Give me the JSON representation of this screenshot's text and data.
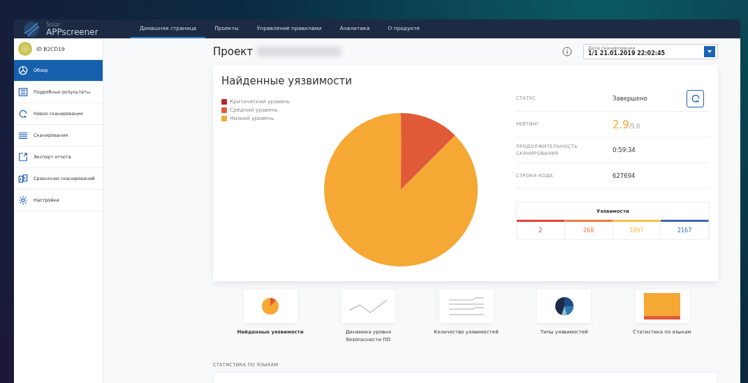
{
  "app": {
    "logo_small": "Solar",
    "logo_main": "APPscreener"
  },
  "nav": [
    {
      "label": "Домашняя страница",
      "selected": true
    },
    {
      "label": "Проекты",
      "selected": false
    },
    {
      "label": "Управление правилами",
      "selected": false
    },
    {
      "label": "Аналитика",
      "selected": false
    },
    {
      "label": "О продукте",
      "selected": false
    }
  ],
  "user": {
    "id": "ID B2CD19"
  },
  "sidebar": {
    "items": [
      {
        "label": "Обзор",
        "selected": true
      },
      {
        "label": "Подробные результаты",
        "selected": false
      },
      {
        "label": "Новое сканирование",
        "selected": false
      },
      {
        "label": "Сканирования",
        "selected": false
      },
      {
        "label": "Экспорт отчета",
        "selected": false
      },
      {
        "label": "Сравнение сканирований",
        "selected": false
      },
      {
        "label": "Настройки",
        "selected": false
      }
    ]
  },
  "project": {
    "title": "Проект"
  },
  "scan_date": {
    "label": "Дата сканирования",
    "value": "1/1 21.01.2019 22:02:45"
  },
  "findings": {
    "title": "Найденные уязвимости",
    "chart_data": {
      "type": "pie",
      "categories": [
        "Критический уровень",
        "Средний уровень",
        "Низкий уровень"
      ],
      "values": [
        0.1,
        12.4,
        87.5
      ],
      "legend": "top-left",
      "colors": [
        "#b8272f",
        "#e05a38",
        "#f5a833"
      ]
    }
  },
  "stats": [
    {
      "label": "СТАТУС",
      "value": "Завершено"
    },
    {
      "label": "РЕЙТИНГ",
      "value": "2.9",
      "suffix": "/5.0"
    },
    {
      "label": "ПРОДОЛЖИТЕЛЬНОСТЬ СКАНИРОВАНИЯ",
      "value": "0:59:34"
    },
    {
      "label": "СТРОКИ КОДА",
      "value": "627694"
    }
  ],
  "vulnerabilities": {
    "title": "Уязвимости",
    "counts": [
      {
        "value": "2",
        "color": "#e0413a"
      },
      {
        "value": "268",
        "color": "#f07a45"
      },
      {
        "value": "1897",
        "color": "#f8c04a"
      },
      {
        "value": "2167",
        "color": "#3a67b5"
      }
    ]
  },
  "tiles": [
    {
      "label": "Найденные уязвимости",
      "kind": "pie",
      "selected": true
    },
    {
      "label": "Динамика уровня безопасности ПО",
      "kind": "line",
      "selected": false
    },
    {
      "label": "Количество уязвимостей",
      "kind": "lines",
      "selected": false
    },
    {
      "label": "Типы уязвимостей",
      "kind": "donut",
      "selected": false
    },
    {
      "label": "Статистика по языкам",
      "kind": "block",
      "selected": false
    }
  ],
  "languages": {
    "title": "СТАТИСТИКА ПО ЯЗЫКАМ"
  }
}
